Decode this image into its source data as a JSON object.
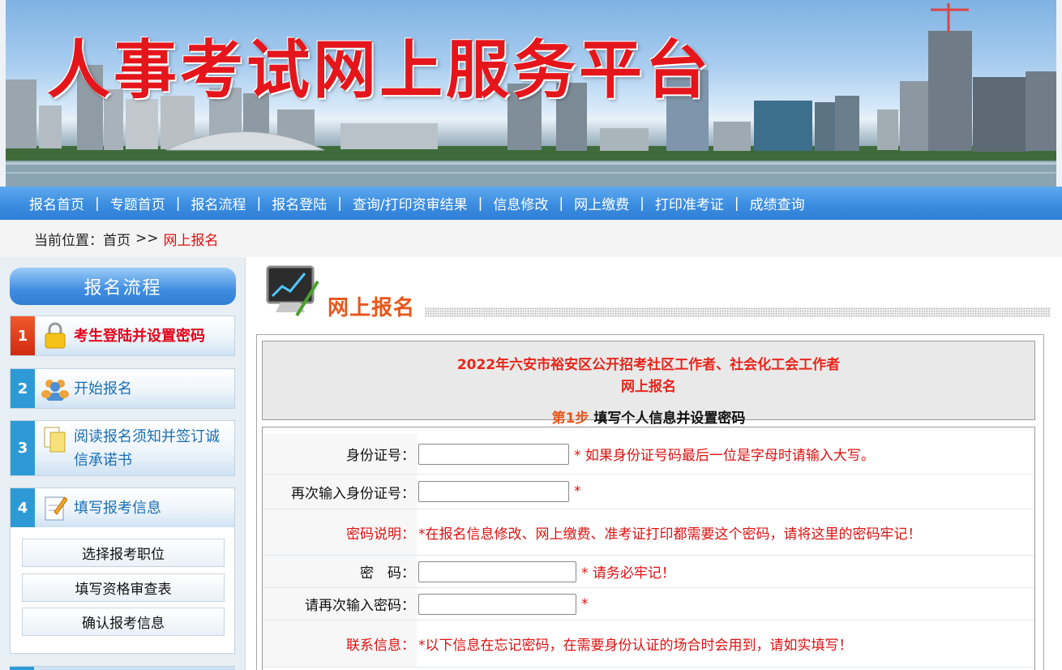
{
  "banner": {
    "title": "人事考试网上服务平台"
  },
  "nav": {
    "items": [
      "报名首页",
      "专题首页",
      "报名流程",
      "报名登陆",
      "查询/打印资审结果",
      "信息修改",
      "网上缴费",
      "打印准考证",
      "成绩查询"
    ],
    "separator": "|"
  },
  "breadcrumb": {
    "prefix": "当前位置：",
    "home": "首页",
    "arrow": ">>",
    "current": "网上报名"
  },
  "sidebar": {
    "header": "报名流程",
    "steps": [
      {
        "num": "1",
        "label": "考生登陆并设置密码",
        "icon": "padlock-icon"
      },
      {
        "num": "2",
        "label": "开始报名",
        "icon": "people-icon"
      },
      {
        "num": "3",
        "label": "阅读报名须知并签订诚信承诺书",
        "icon": "documents-icon"
      },
      {
        "num": "4",
        "label": "填写报考信息",
        "icon": "edit-note-icon"
      }
    ],
    "substeps": [
      "选择报考职位",
      "填写资格审查表",
      "确认报考信息"
    ]
  },
  "main": {
    "section_title": "网上报名",
    "exam_title": "2022年六安市裕安区公开招考社区工作者、社会化工会工作者",
    "exam_subtitle": "网上报名",
    "step_no": "第1步",
    "step_title": "填写个人信息并设置密码",
    "rows": [
      {
        "label": "身份证号：",
        "note": "* 如果身份证号码最后一位是字母时请输入大写。",
        "input": ""
      },
      {
        "label": "再次输入身份证号：",
        "note": "*",
        "input": ""
      },
      {
        "label": "密码说明：",
        "note": "*在报名信息修改、网上缴费、准考证打印都需要这个密码，请将这里的密码牢记！"
      },
      {
        "label": "密　码：",
        "note": "* 请务必牢记！",
        "input": ""
      },
      {
        "label": "请再次输入密码：",
        "note": "*",
        "input": ""
      },
      {
        "label": "联系信息：",
        "note": "*以下信息在忘记密码，在需要身份认证的场合时会用到，请如实填写！"
      }
    ]
  },
  "colors": {
    "nav_blue": "#3b8de0",
    "accent_red": "#e2061c",
    "title_orange": "#e8561b"
  }
}
